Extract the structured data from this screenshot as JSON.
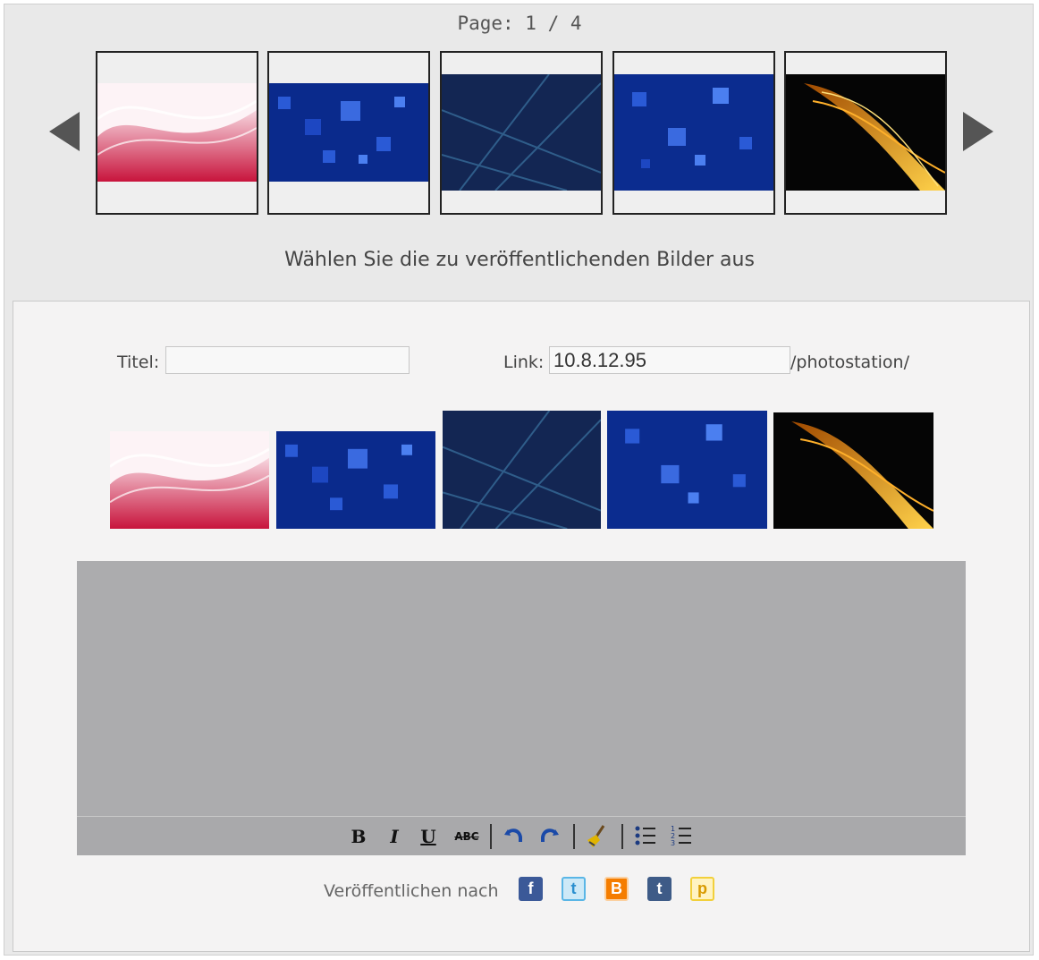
{
  "pager": {
    "label": "Page: 1 / 4"
  },
  "thumbnails": [
    {
      "name": "pink-waves"
    },
    {
      "name": "blue-squares"
    },
    {
      "name": "dark-blue-lines"
    },
    {
      "name": "blue-squares-2"
    },
    {
      "name": "fire-flame"
    }
  ],
  "instruction": "Wählen Sie die zu veröffentlichenden Bilder aus",
  "form": {
    "title_label": "Titel:",
    "title_value": "",
    "link_label": "Link:",
    "link_value": "10.8.12.95",
    "link_suffix": "/photostation/"
  },
  "editor": {
    "toolbar": [
      "bold",
      "italic",
      "underline",
      "strikethrough",
      "undo",
      "redo",
      "clean",
      "bullet-list",
      "numbered-list"
    ],
    "bold_label": "B",
    "italic_label": "I",
    "underline_label": "U",
    "strike_label": "ABC"
  },
  "publish": {
    "label": "Veröffentlichen nach",
    "targets": [
      "facebook",
      "twitter",
      "blogger",
      "tumblr",
      "plurk"
    ]
  },
  "colors": {
    "facebook": "#3b5998",
    "twitter": "#5ab6e6",
    "blogger": "#f57d00",
    "tumblr": "#3e5b87",
    "plurk": "#f2d03b"
  }
}
